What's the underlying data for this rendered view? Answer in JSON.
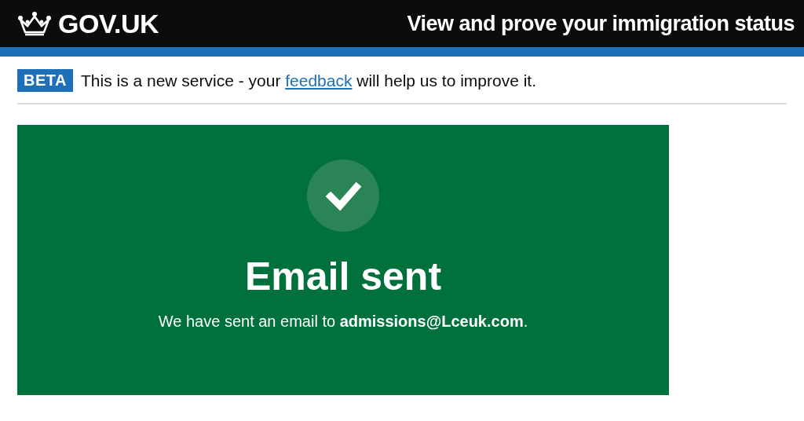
{
  "header": {
    "logo": "GOV.UK",
    "service_name": "View and prove your immigration status"
  },
  "phase_banner": {
    "tag": "BETA",
    "text_before": "This is a new service - your",
    "link": "feedback",
    "text_after": "will help us to improve it."
  },
  "panel": {
    "title": "Email sent",
    "body": "We have sent an email to **admissions@Lceuk.com**."
  }
}
